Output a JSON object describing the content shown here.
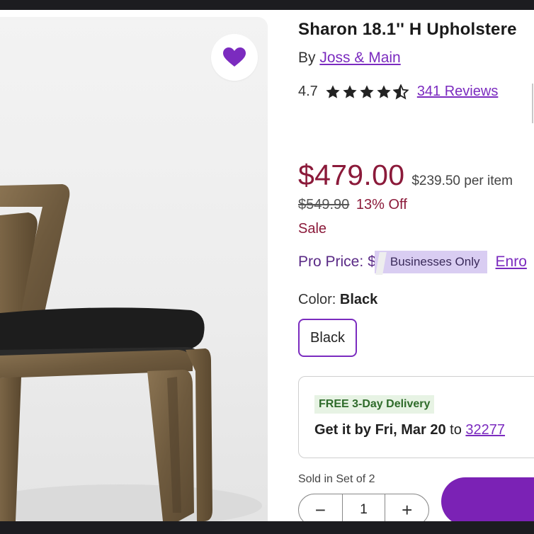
{
  "product": {
    "title": "Sharon 18.1'' H Upholstere",
    "by_prefix": "By ",
    "brand": "Joss & Main",
    "rating": "4.7",
    "stars_filled": 4.5,
    "reviews": "341 Reviews"
  },
  "pricing": {
    "price": "$479.00",
    "per_item": "$239.50 per item",
    "original": "$549.90",
    "discount": "13% Off",
    "sale_label": "Sale",
    "pro_label": "Pro Price:",
    "pro_masked": "$",
    "pro_badge": "Businesses Only",
    "enroll": "Enro"
  },
  "color": {
    "label": "Color:",
    "selected": "Black",
    "swatch": "Black"
  },
  "delivery": {
    "badge": "FREE 3-Day Delivery",
    "get_it": "Get it by Fri, Mar 20",
    "to": " to ",
    "zip": "32277"
  },
  "quantity": {
    "sold_in": "Sold in Set of 2",
    "value": "1",
    "minus": "−",
    "plus": "+"
  },
  "colors": {
    "accent": "#7b2bbf",
    "price": "#8b1a3a",
    "cart": "#7b22b5"
  },
  "icons": {
    "favorite": "heart-icon",
    "star": "star-icon"
  }
}
